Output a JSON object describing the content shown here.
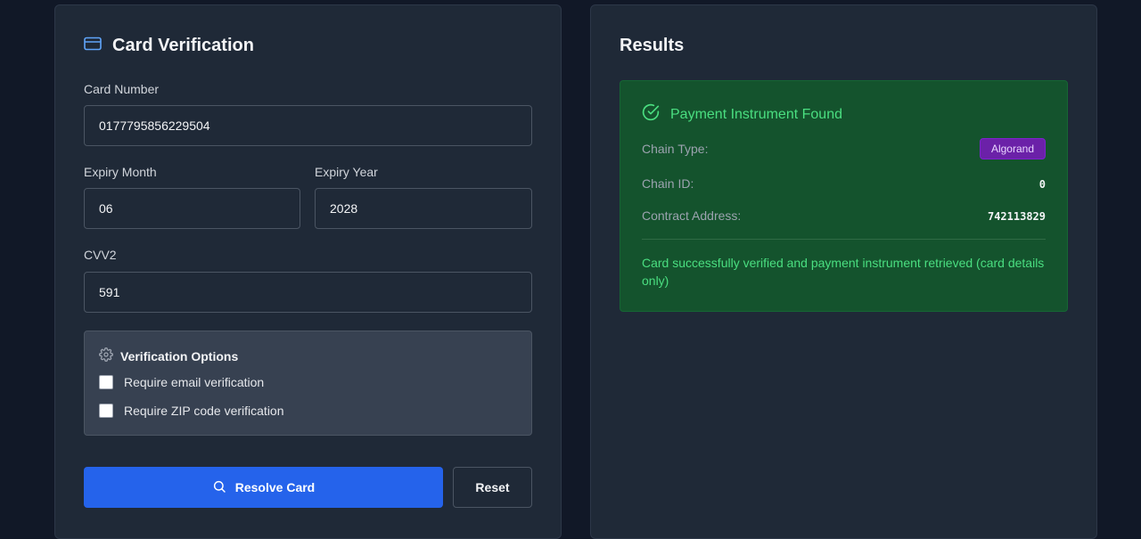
{
  "verification": {
    "title": "Card Verification",
    "card_number_label": "Card Number",
    "card_number_value": "0177795856229504",
    "expiry_month_label": "Expiry Month",
    "expiry_month_value": "06",
    "expiry_year_label": "Expiry Year",
    "expiry_year_value": "2028",
    "cvv_label": "CVV2",
    "cvv_value": "591",
    "options": {
      "title": "Verification Options",
      "email_label": "Require email verification",
      "email_checked": false,
      "zip_label": "Require ZIP code verification",
      "zip_checked": false
    },
    "resolve_label": "Resolve Card",
    "reset_label": "Reset"
  },
  "results": {
    "title": "Results",
    "status": "Payment Instrument Found",
    "chain_type_label": "Chain Type:",
    "chain_type_value": "Algorand",
    "chain_id_label": "Chain ID:",
    "chain_id_value": "0",
    "contract_address_label": "Contract Address:",
    "contract_address_value": "742113829",
    "message": "Card successfully verified and payment instrument retrieved (card details only)"
  },
  "colors": {
    "background": "#111827",
    "panel": "#1f2937",
    "primary": "#2563eb",
    "success_bg": "#14532d",
    "success_text": "#4ade80",
    "badge": "#6b21a8"
  },
  "icons": {
    "title": "credit-card-icon",
    "options": "gear-icon",
    "resolve": "search-icon",
    "status": "check-circle-icon"
  }
}
